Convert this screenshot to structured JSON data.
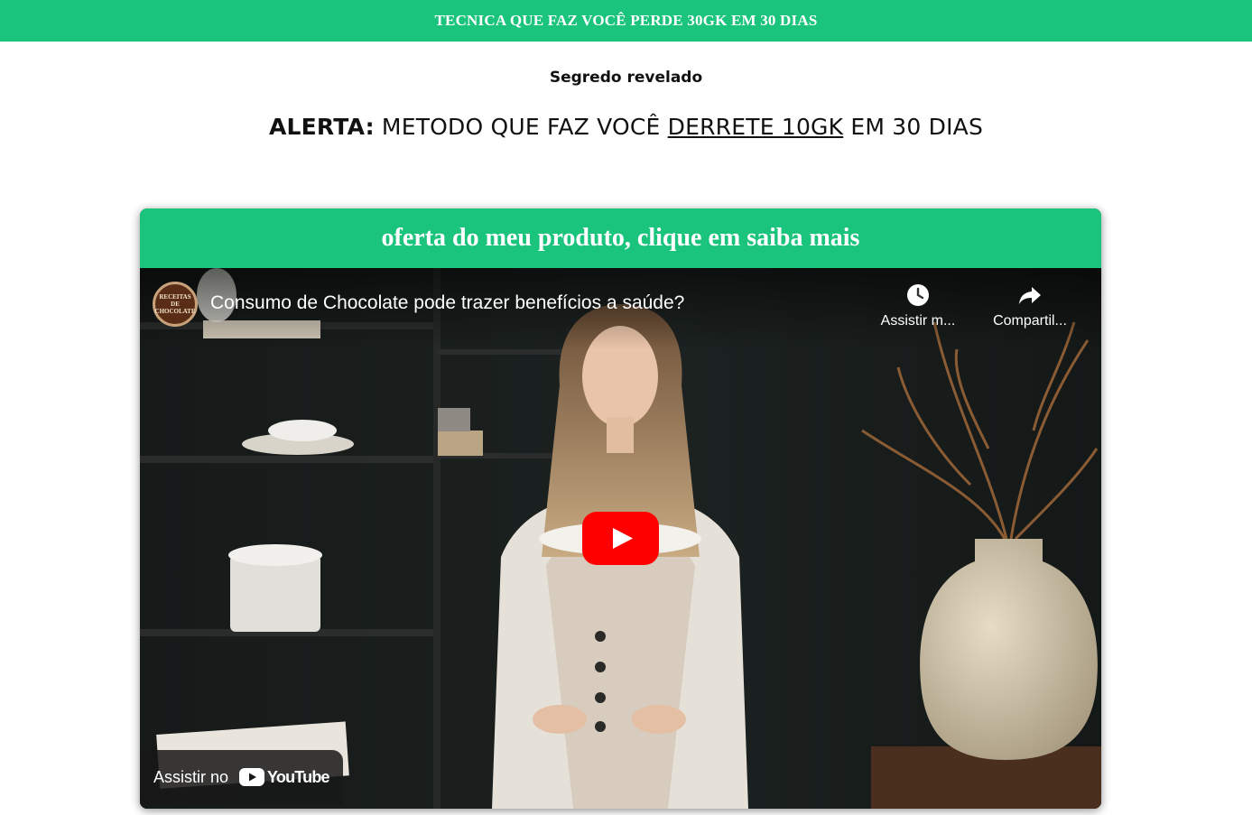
{
  "topbar": {
    "text": "TECNICA QUE FAZ VOCÊ PERDE 30GK EM 30 DIAS"
  },
  "subtitle": "Segredo revelado",
  "headline": {
    "strong": "ALERTA:",
    "text_before": " METODO QUE FAZ VOCÊ ",
    "underlined": "DERRETE 10GK",
    "text_after": " EM 30 DIAS"
  },
  "offer": {
    "header": "oferta do meu produto, clique em saiba mais"
  },
  "video": {
    "title": "Consumo de Chocolate pode trazer benefícios a saúde?",
    "channel_logo_text": "RECEITAS DE CHOCOLATE",
    "watch_later_label": "Assistir m...",
    "share_label": "Compartil...",
    "watch_on_label": "Assistir no",
    "youtube_wordmark": "YouTube",
    "icons": {
      "watch_later": "clock-icon",
      "share": "share-arrow-icon",
      "play": "play-icon",
      "youtube": "youtube-logo-icon"
    }
  },
  "colors": {
    "brand_green": "#1bc47d",
    "play_red": "#ff0000"
  }
}
